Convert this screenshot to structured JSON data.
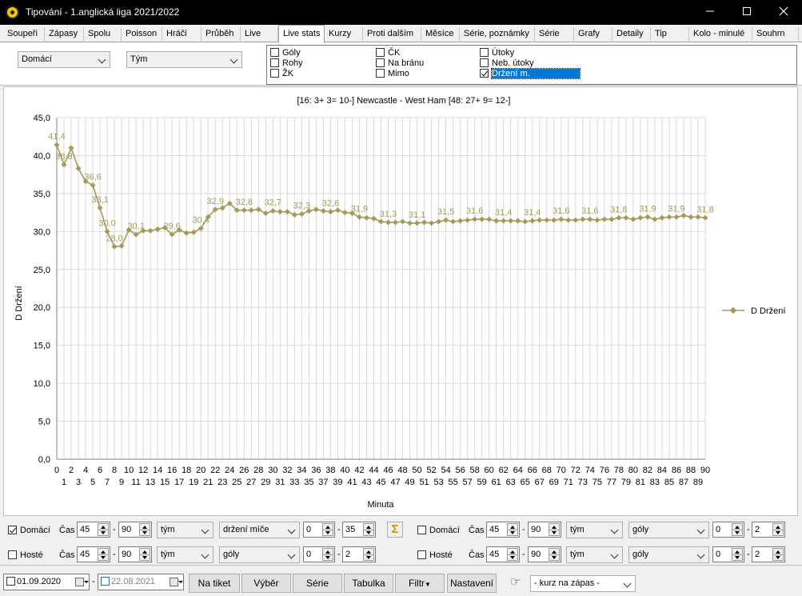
{
  "window": {
    "title": "Tipování - 1.anglická liga 2021/2022",
    "min_icon": "minimize-icon",
    "max_icon": "maximize-icon",
    "close_icon": "close-icon"
  },
  "tabs": [
    "Soupeři",
    "Zápasy",
    "Spolu",
    "Poisson",
    "Hráči",
    "Průběh",
    "Live",
    "Live stats",
    "Kurzy",
    "Proti dalším",
    "Měsíce",
    "Série, poznámky",
    "Série",
    "Grafy",
    "Detaily",
    "Tip",
    "Kolo - minulé",
    "Souhrn"
  ],
  "active_tab": "Live stats",
  "filters": {
    "side": "Domácí",
    "team": "Tým"
  },
  "checkboxes": {
    "goly": {
      "label": "Góly",
      "checked": false
    },
    "rohy": {
      "label": "Rohy",
      "checked": false
    },
    "zk": {
      "label": "ŽK",
      "checked": false
    },
    "ck": {
      "label": "ČK",
      "checked": false
    },
    "na_branu": {
      "label": "Na bránu",
      "checked": false
    },
    "mimo": {
      "label": "Mimo",
      "checked": false
    },
    "utoky": {
      "label": "Útoky",
      "checked": false
    },
    "neb_utoky": {
      "label": "Neb. útoky",
      "checked": false
    },
    "drzeni": {
      "label": "Držení m.",
      "checked": true
    }
  },
  "chart_data": {
    "type": "line",
    "title": "[16:  3+  3=  10-] Newcastle - West Ham [48:  27+  9=  12-]",
    "xlabel": "Minuta",
    "ylabel": "D Držení",
    "xlim": [
      0,
      90
    ],
    "ylim": [
      0,
      45
    ],
    "yticks": [
      "0,0",
      "5,0",
      "10,0",
      "15,0",
      "20,0",
      "25,0",
      "30,0",
      "35,0",
      "40,0",
      "45,0"
    ],
    "grid": true,
    "legend_position": "right",
    "line_color": "#a39a5b",
    "series": [
      {
        "name": "D Držení",
        "x": [
          0,
          1,
          2,
          3,
          4,
          5,
          6,
          7,
          8,
          9,
          10,
          11,
          12,
          13,
          14,
          15,
          16,
          17,
          18,
          19,
          20,
          21,
          22,
          23,
          24,
          25,
          26,
          27,
          28,
          29,
          30,
          31,
          32,
          33,
          34,
          35,
          36,
          37,
          38,
          39,
          40,
          41,
          42,
          43,
          44,
          45,
          46,
          47,
          48,
          49,
          50,
          51,
          52,
          53,
          54,
          55,
          56,
          57,
          58,
          59,
          60,
          61,
          62,
          63,
          64,
          65,
          66,
          67,
          68,
          69,
          70,
          71,
          72,
          73,
          74,
          75,
          76,
          77,
          78,
          79,
          80,
          81,
          82,
          83,
          84,
          85,
          86,
          87,
          88,
          89,
          90
        ],
        "values": [
          41.4,
          38.8,
          41.0,
          38.3,
          36.6,
          36.1,
          33.1,
          30.0,
          28.0,
          28.1,
          30.2,
          29.6,
          30.1,
          30.1,
          30.3,
          30.5,
          29.6,
          30.2,
          29.8,
          29.9,
          30.4,
          31.9,
          32.9,
          33.1,
          33.7,
          32.8,
          32.8,
          32.8,
          32.9,
          32.4,
          32.7,
          32.6,
          32.6,
          32.2,
          32.3,
          32.7,
          32.9,
          32.7,
          32.6,
          32.8,
          32.5,
          32.4,
          31.9,
          31.8,
          31.7,
          31.3,
          31.2,
          31.2,
          31.3,
          31.1,
          31.1,
          31.2,
          31.1,
          31.3,
          31.5,
          31.3,
          31.4,
          31.5,
          31.6,
          31.6,
          31.6,
          31.4,
          31.4,
          31.4,
          31.4,
          31.3,
          31.4,
          31.5,
          31.5,
          31.5,
          31.6,
          31.5,
          31.5,
          31.6,
          31.6,
          31.5,
          31.6,
          31.6,
          31.8,
          31.8,
          31.6,
          31.8,
          31.9,
          31.6,
          31.8,
          31.9,
          31.9,
          32.1,
          31.9,
          31.9,
          31.8
        ],
        "labels": {
          "0": "41,4",
          "1": "38,8",
          "5": "36,6",
          "6": "33,1",
          "7": "30,0",
          "8": "28,0",
          "11": "30,1",
          "16": "29,6",
          "20": "30,4",
          "22": "32,9",
          "26": "32,8",
          "30": "32,7",
          "34": "32,3",
          "38": "32,6",
          "42": "31,9",
          "46": "31,3",
          "50": "31,1",
          "54": "31,5",
          "58": "31,6",
          "62": "31,4",
          "66": "31,4",
          "70": "31,6",
          "74": "31,6",
          "78": "31,8",
          "82": "31,9",
          "86": "31,9",
          "90": "31,8"
        }
      }
    ]
  },
  "row1_left": {
    "label": "Domácí",
    "checked": true,
    "cas": "Čas",
    "from": "45",
    "to": "90",
    "scope": "tým",
    "stat": "držení míče",
    "min": "0",
    "max": "35"
  },
  "row2_left": {
    "label": "Hosté",
    "checked": false,
    "cas": "Čas",
    "from": "45",
    "to": "90",
    "scope": "tým",
    "stat": "góly",
    "min": "0",
    "max": "2"
  },
  "row1_right": {
    "label": "Domácí",
    "checked": false,
    "cas": "Čas",
    "from": "45",
    "to": "90",
    "scope": "tým",
    "stat": "góly",
    "min": "0",
    "max": "2"
  },
  "row2_right": {
    "label": "Hosté",
    "checked": false,
    "cas": "Čas",
    "from": "45",
    "to": "90",
    "scope": "tým",
    "stat": "góly",
    "min": "0",
    "max": "2"
  },
  "sigma_icon": "sigma-icon",
  "sigma_glyph": "Σ",
  "footer": {
    "date_from": "01.09.2020",
    "date_from_checked": true,
    "date_to": "22.08.2021",
    "date_to_checked": false,
    "buttons": [
      "Na tiket",
      "Výběr",
      "Série",
      "Tabulka",
      "Filtr",
      "Nastavení"
    ],
    "hand_icon": "pointing-hand-icon",
    "kurz": "- kurz na zápas -"
  }
}
